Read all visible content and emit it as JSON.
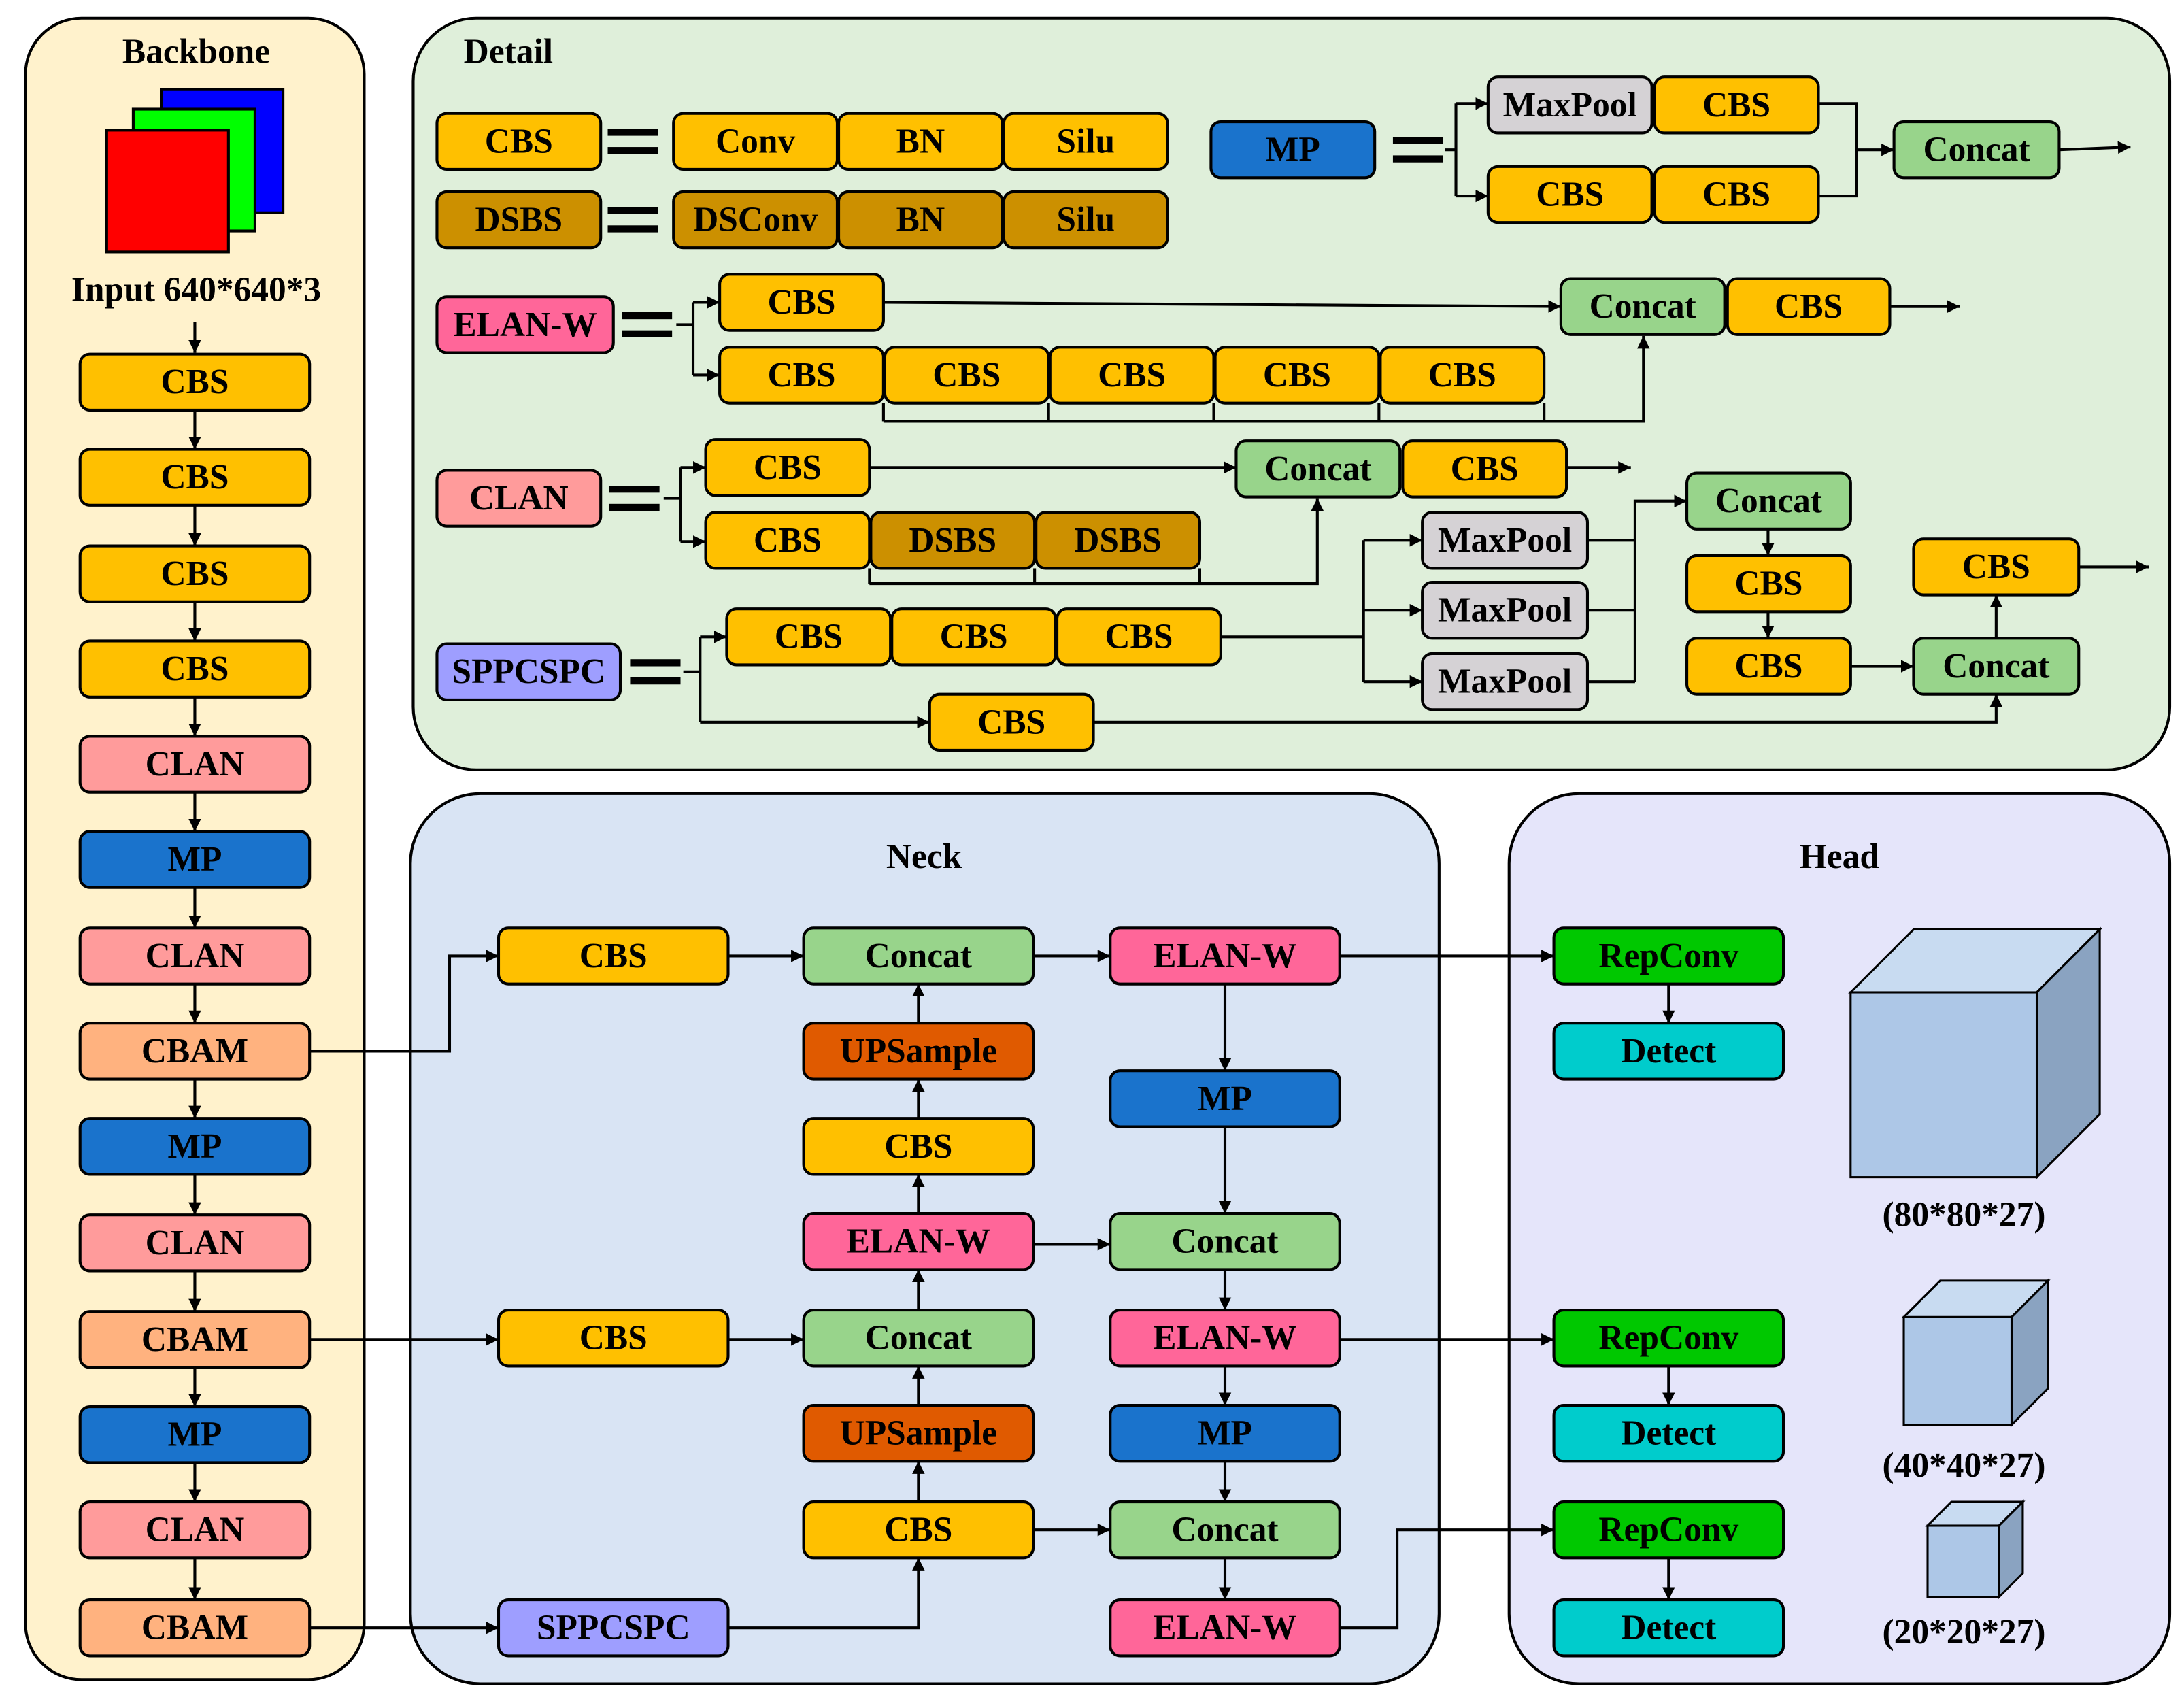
{
  "panels": {
    "backbone": "Backbone",
    "detail": "Detail",
    "neck": "Neck",
    "head": "Head"
  },
  "backbone": {
    "input_label": "Input  640*640*3",
    "blocks": [
      "CBS",
      "CBS",
      "CBS",
      "CBS",
      "CLAN",
      "MP",
      "CLAN",
      "CBAM",
      "MP",
      "CLAN",
      "CBAM",
      "MP",
      "CLAN",
      "CBAM"
    ]
  },
  "detail": {
    "cbs_def": {
      "name": "CBS",
      "parts": [
        "Conv",
        "BN",
        "Silu"
      ]
    },
    "dsbs_def": {
      "name": "DSBS",
      "parts": [
        "DSConv",
        "BN",
        "Silu"
      ]
    },
    "mp_def": {
      "name": "MP",
      "branch1": [
        "MaxPool",
        "CBS"
      ],
      "branch2": [
        "CBS",
        "CBS"
      ],
      "output": "Concat"
    },
    "elanw_def": {
      "name": "ELAN-W",
      "branch1": "CBS",
      "chain": [
        "CBS",
        "CBS",
        "CBS",
        "CBS",
        "CBS"
      ],
      "concat": "Concat",
      "output": "CBS"
    },
    "clan_def": {
      "name": "CLAN",
      "branch1": "CBS",
      "chain": [
        "CBS",
        "DSBS",
        "DSBS"
      ],
      "concat": "Concat",
      "output": "CBS"
    },
    "sppcspc_def": {
      "name": "SPPCSPC",
      "chain": [
        "CBS",
        "CBS",
        "CBS"
      ],
      "shortcut": "CBS",
      "pools": [
        "MaxPool",
        "MaxPool",
        "MaxPool"
      ],
      "concat1": "Concat",
      "post": [
        "CBS",
        "CBS"
      ],
      "concat2": "Concat",
      "output": "CBS"
    }
  },
  "neck": {
    "nodes": [
      "CBS",
      "Concat",
      "ELAN-W",
      "UPSample",
      "MP",
      "CBS",
      "ELAN-W",
      "Concat",
      "CBS",
      "Concat",
      "ELAN-W",
      "UPSample",
      "MP",
      "CBS",
      "Concat",
      "SPPCSPC",
      "ELAN-W"
    ]
  },
  "head": {
    "repconv": [
      "RepConv",
      "RepConv",
      "RepConv"
    ],
    "detect": [
      "Detect",
      "Detect",
      "Detect"
    ],
    "output_shapes": [
      "(80*80*27)",
      "(40*40*27)",
      "(20*20*27)"
    ]
  },
  "colors": {
    "CBS": "#FFC000",
    "DSBS": "#CC9000",
    "CLAN": "#FF9B9B",
    "MP": "#1A73CC",
    "ELAN-W": "#FF6699",
    "Concat": "#98D48B",
    "MaxPool": "#D5D2D5",
    "SPPCSPC": "#9E9EFF",
    "CBAM": "#FFB27F",
    "UPSample": "#E05A00",
    "RepConv": "#00C800",
    "Detect": "#00CCCC",
    "backbone_bg": "#FFF2CC",
    "detail_bg": "#DFEFDA",
    "neck_bg": "#D9E4F4",
    "head_bg": "#E5E5FA",
    "cube_front": "#ADC7E7",
    "cube_top": "#C8DBF1",
    "cube_side": "#8AA3C1"
  }
}
